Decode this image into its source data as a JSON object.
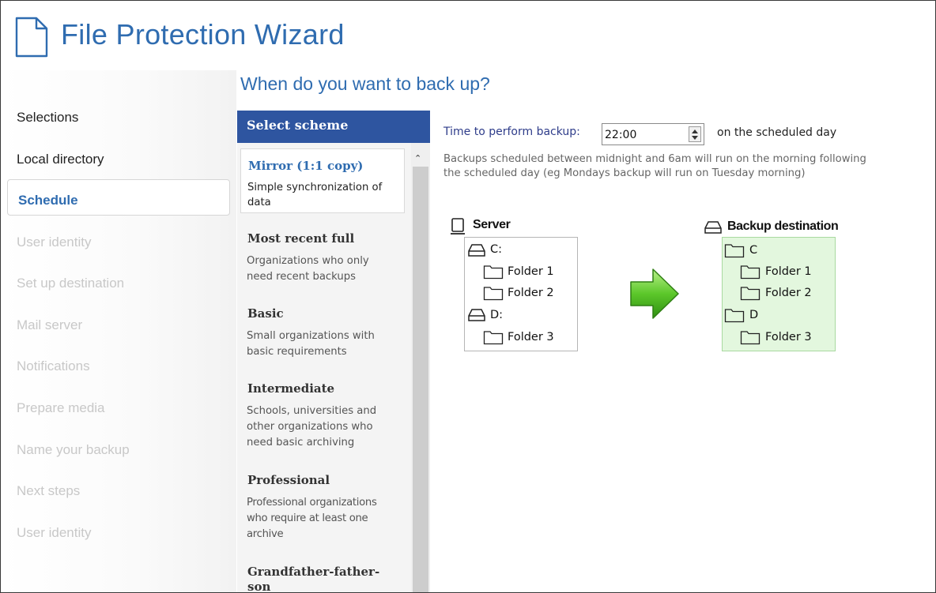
{
  "app": {
    "title": "File Protection Wizard",
    "page_heading": "When do you want to back up?"
  },
  "sidebar": {
    "items": [
      {
        "label": "Selections",
        "state": "normal"
      },
      {
        "label": "Local directory",
        "state": "normal"
      },
      {
        "label": "Schedule",
        "state": "active"
      },
      {
        "label": "User identity",
        "state": "disabled"
      },
      {
        "label": "Set up destination",
        "state": "disabled"
      },
      {
        "label": "Mail server",
        "state": "disabled"
      },
      {
        "label": "Notifications",
        "state": "disabled"
      },
      {
        "label": "Prepare media",
        "state": "disabled"
      },
      {
        "label": "Name your backup",
        "state": "disabled"
      },
      {
        "label": "Next steps",
        "state": "disabled"
      },
      {
        "label": "User identity",
        "state": "disabled"
      }
    ]
  },
  "schemes": {
    "header": "Select scheme",
    "items": [
      {
        "title": "Mirror (1:1 copy)",
        "description": [
          "Simple synchronization of",
          "data"
        ],
        "selected": true
      },
      {
        "title": "Most recent full",
        "description": [
          "Organizations who only",
          "need recent backups"
        ],
        "selected": false
      },
      {
        "title": "Basic",
        "description": [
          "Small organizations with",
          "basic requirements"
        ],
        "selected": false
      },
      {
        "title": "Intermediate",
        "description": [
          "Schools, universities and",
          "other organizations who",
          "need basic archiving"
        ],
        "selected": false
      },
      {
        "title": "Professional",
        "description": [
          "Professional organizations",
          "who require at least one",
          "archive"
        ],
        "selected": false
      },
      {
        "title": "Grandfather-father-son",
        "title_lines": [
          "Grandfather-father-",
          "son"
        ],
        "description": [],
        "selected": false
      }
    ]
  },
  "schedule": {
    "time_label": "Time to perform backup:",
    "time_value": "22:00",
    "time_suffix": "on the scheduled day",
    "note_line1": "Backups scheduled between midnight and 6am will run on the morning following",
    "note_line2": "the scheduled day (eg Mondays backup will run on Tuesday morning)"
  },
  "diagram": {
    "source": {
      "title": "Server",
      "icon": "computer-icon",
      "drives": [
        {
          "label": "C:",
          "icon": "drive-icon",
          "folders": [
            "Folder 1",
            "Folder 2"
          ]
        },
        {
          "label": "D:",
          "icon": "drive-icon",
          "folders": [
            "Folder 3"
          ]
        }
      ]
    },
    "destination": {
      "title": "Backup destination",
      "icon": "drive-icon",
      "drives": [
        {
          "label": "C",
          "icon": "folder-icon",
          "folders": [
            "Folder 1",
            "Folder 2"
          ]
        },
        {
          "label": "D",
          "icon": "folder-icon",
          "folders": [
            "Folder 3"
          ]
        }
      ]
    },
    "arrow_icon": "green-right-arrow-icon"
  },
  "colors": {
    "accent": "#2f6cb0",
    "scheme_header": "#2e55a0",
    "destination_bg": "#e3f7de",
    "arrow": "#5cc72a"
  }
}
